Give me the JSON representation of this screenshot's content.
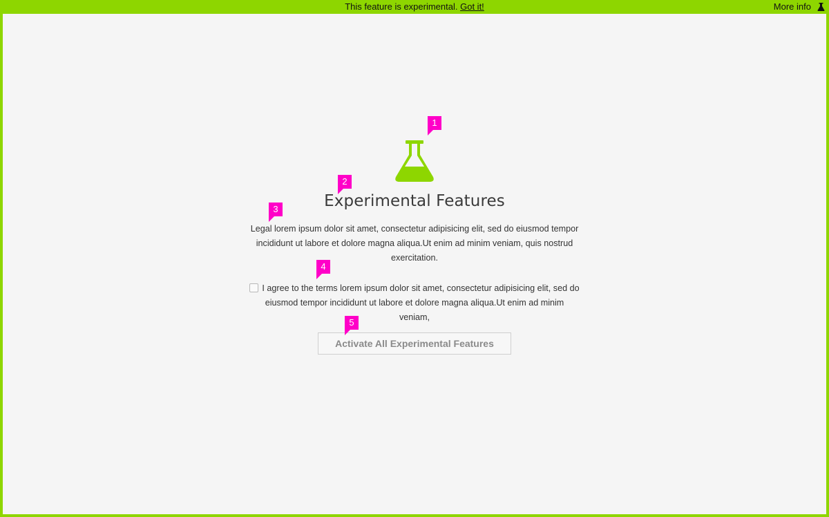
{
  "banner": {
    "message": "This feature is experimental.",
    "got_it": "Got it!",
    "more_info": "More info"
  },
  "main": {
    "title": "Experimental Features",
    "legal_text": "Legal lorem ipsum dolor sit amet, consectetur adipisicing elit, sed do eiusmod tempor incididunt ut labore et dolore magna aliqua.Ut enim ad minim veniam, quis nostrud exercitation.",
    "agree_text": "I agree to the terms lorem ipsum dolor sit amet, consectetur adipisicing elit, sed do eiusmod tempor incididunt ut labore et dolore magna aliqua.Ut enim ad minim veniam,",
    "activate_label": "Activate All Experimental Features",
    "agree_checked": false
  },
  "annotations": {
    "m1": "1",
    "m2": "2",
    "m3": "3",
    "m4": "4",
    "m5": "5"
  },
  "icons": {
    "small_flask": "flask-icon",
    "big_flask": "flask-icon"
  },
  "colors": {
    "accent": "#8ed600",
    "annotation": "#ff00c8",
    "background": "#f5f5f5"
  }
}
